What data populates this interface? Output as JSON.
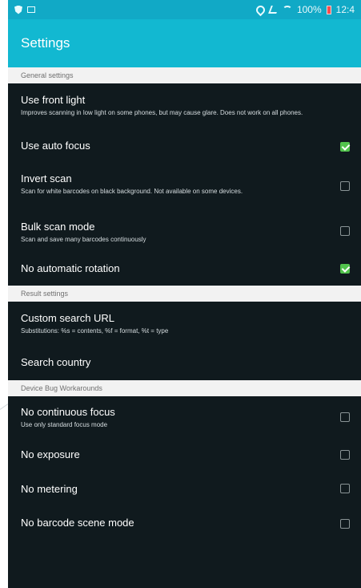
{
  "status_bar": {
    "time": "12:4",
    "battery_text": "100%",
    "icons": [
      "shield-icon",
      "screen-icon",
      "location-icon",
      "signal-icon",
      "wifi-icon",
      "battery-icon"
    ]
  },
  "app_bar": {
    "title": "Settings"
  },
  "sections": [
    {
      "label": "General settings",
      "items": [
        {
          "title": "Use front light",
          "summary": "Improves scanning in low light on some phones, but may cause glare. Does not work on all phones.",
          "checked": null
        },
        {
          "title": "Use auto focus",
          "summary": "",
          "checked": true
        },
        {
          "title": "Invert scan",
          "summary": "Scan for white barcodes on black background. Not available on some devices.",
          "checked": false
        },
        {
          "title": "Bulk scan mode",
          "summary": "Scan and save many barcodes continuously",
          "checked": false
        },
        {
          "title": "No automatic rotation",
          "summary": "",
          "checked": true
        }
      ]
    },
    {
      "label": "Result settings",
      "items": [
        {
          "title": "Custom search URL",
          "summary": "Substitutions: %s = contents, %f = format, %t = type",
          "checked": null
        },
        {
          "title": "Search country",
          "summary": "",
          "checked": null
        }
      ]
    },
    {
      "label": "Device Bug Workarounds",
      "items": [
        {
          "title": "No continuous focus",
          "summary": "Use only standard focus mode",
          "checked": false
        },
        {
          "title": "No exposure",
          "summary": "",
          "checked": false
        },
        {
          "title": "No metering",
          "summary": "",
          "checked": false
        },
        {
          "title": "No barcode scene mode",
          "summary": "",
          "checked": false
        }
      ]
    }
  ],
  "colors": {
    "status_bar": "#11a9c6",
    "app_bar": "#12b8d1",
    "background": "#101a1e",
    "section_header": "#f2f2f2",
    "checkbox_checked": "#52c34d"
  }
}
